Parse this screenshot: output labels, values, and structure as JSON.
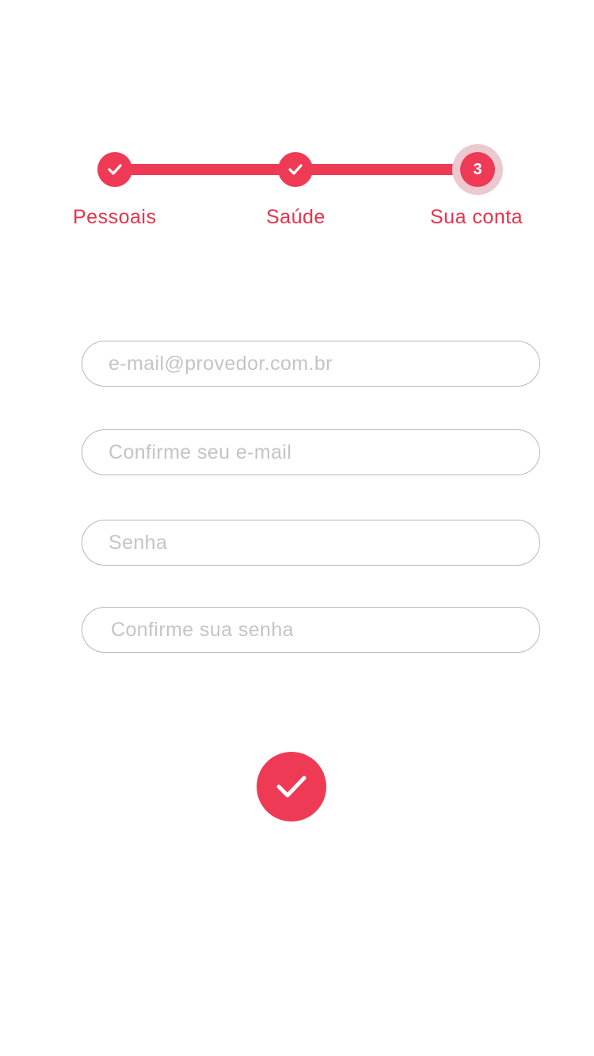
{
  "stepper": {
    "steps": [
      {
        "label": "Pessoais",
        "state": "complete",
        "icon": "check-icon"
      },
      {
        "label": "Saúde",
        "state": "complete",
        "icon": "check-icon"
      },
      {
        "label": "Sua conta",
        "state": "current",
        "number": "3"
      }
    ]
  },
  "form": {
    "email": {
      "placeholder": "e-mail@provedor.com.br",
      "value": ""
    },
    "email_confirm": {
      "placeholder": "Confirme seu e-mail",
      "value": ""
    },
    "password": {
      "placeholder": "Senha",
      "value": ""
    },
    "password_confirm": {
      "placeholder": "Confirme sua senha",
      "value": ""
    },
    "submit": {
      "icon": "check-icon"
    }
  },
  "colors": {
    "accent": "#ef3a55",
    "accent_text": "#e8324d",
    "halo": "#ecc8cf",
    "field_border": "#b8b8b8",
    "placeholder": "#c4c4c4"
  }
}
